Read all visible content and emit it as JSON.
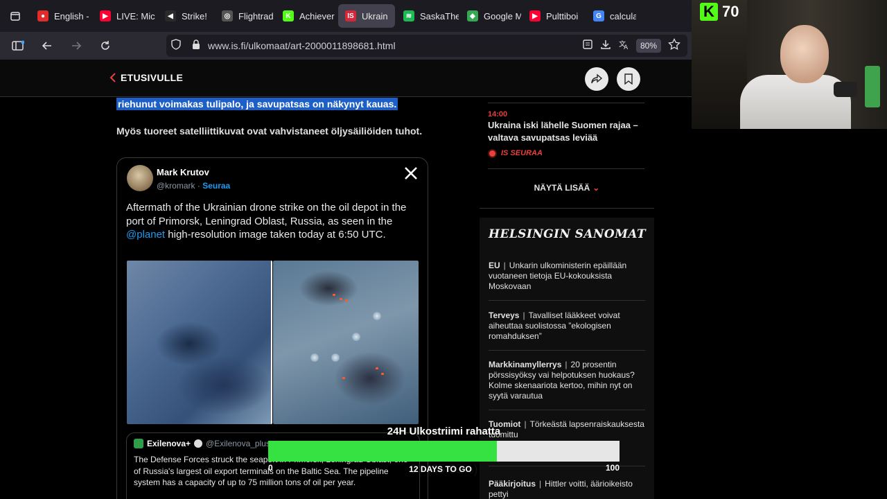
{
  "browser": {
    "tabs": [
      {
        "label": "English -",
        "fav_color": "#e22b2b",
        "fav_glyph": "●"
      },
      {
        "label": "LIVE: Mic",
        "fav_color": "#ff0033",
        "fav_glyph": "▶"
      },
      {
        "label": "Strike!",
        "fav_color": "#2a2a2a",
        "fav_glyph": "◀"
      },
      {
        "label": "Flightrad",
        "fav_color": "#555555",
        "fav_glyph": "◎"
      },
      {
        "label": "Achiever",
        "fav_color": "#53fc18",
        "fav_glyph": "K"
      },
      {
        "label": "Ukrain",
        "fav_color": "#d4283a",
        "fav_glyph": "IS",
        "active": true
      },
      {
        "label": "SaskaThe",
        "fav_color": "#1db954",
        "fav_glyph": "≋"
      },
      {
        "label": "Google M",
        "fav_color": "#34a853",
        "fav_glyph": "◆"
      },
      {
        "label": "Pulttiboi",
        "fav_color": "#ff0033",
        "fav_glyph": "▶"
      },
      {
        "label": "calculat",
        "fav_color": "#4285f4",
        "fav_glyph": "G"
      }
    ],
    "tab_close": "✕",
    "url": "www.is.fi/ulkomaat/art-2000011898681.html",
    "zoom": "80%",
    "icons": [
      "tab-list-icon",
      "sidebar-icon",
      "back-icon",
      "forward-icon",
      "reload-icon",
      "shield-icon",
      "lock-icon",
      "reader-icon",
      "save-icon",
      "translate-icon",
      "star-icon"
    ]
  },
  "site_header": {
    "back_label": "ETUSIVULLE",
    "accent": "#e8403a"
  },
  "article": {
    "highlight": "riehunut voimakas tulipalo, ja savupatsas on näkynyt kauas.",
    "paragraph": "Myös tuoreet satelliittikuvat ovat vahvistaneet öljysäiliöiden tuhot.",
    "tweet": {
      "name": "Mark Krutov",
      "handle": "@kromark",
      "separator": " · ",
      "follow": "Seuraa",
      "body_before": "Aftermath of the Ukrainian drone strike on the oil depot in the port of Primorsk, Leningrad Oblast, Russia, as seen in the ",
      "mention": "@planet",
      "body_after": " high-resolution image taken today at 6:50 UTC.",
      "quote": {
        "name": "Exilenova+",
        "handle": "@Exilenova_plus",
        "body": "The Defense Forces struck the seaport in Primorsk, Leningrad Oblast, one of Russia's largest oil export terminals on the Baltic Sea. The pipeline system has a capacity of up to 75 million tons of oil per year."
      }
    }
  },
  "sidebar": {
    "latest": {
      "time": "14:00",
      "title": "Ukraina iski lähelle Suomen rajaa – valtava savupatsas leviää",
      "live_label": "IS SEURAA"
    },
    "more_label": "NÄYTÄ LISÄÄ",
    "hs": {
      "logo": "HELSINGIN SANOMAT",
      "items": [
        {
          "cat": "EU",
          "text": "Unkarin ulkoministerin epäillään vuotaneen tietoja EU-kokouksista Moskovaan"
        },
        {
          "cat": "Terveys",
          "text": "Tavalliset lääkkeet voivat aiheuttaa suolistossa ”ekologisen romahduksen”"
        },
        {
          "cat": "Markkinamyllerrys",
          "text": "20 prosentin pörssisyöksy vai helpotuksen huokaus? Kolme skenaariota kertoo, mihin nyt on syytä varautua"
        },
        {
          "cat": "Tuomiot",
          "text": "Törkeästä lapsenraiskauksesta tuomittu"
        },
        {
          "cat": "Pääkirjoitus",
          "text": "Hittler voitti, äärioikeisto pettyi"
        }
      ]
    }
  },
  "stream": {
    "platform_logo": "K",
    "viewer_count": "70",
    "goal": {
      "title": "24H Ulkostriimi rahatta",
      "value_label": "65 (65.00%)",
      "fraction": 0.65,
      "min": "0",
      "max": "100",
      "days_label": "12 DAYS TO GO",
      "fill_color": "#35e241"
    }
  }
}
